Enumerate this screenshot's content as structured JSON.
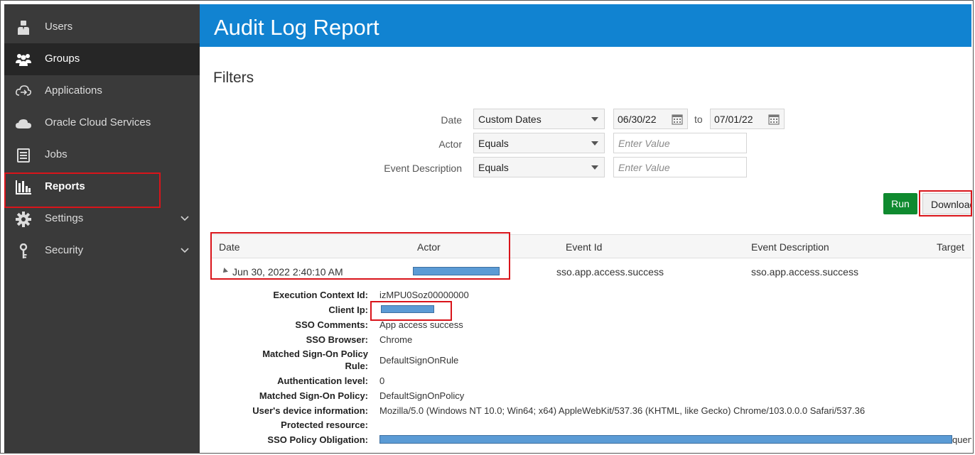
{
  "sidebar": {
    "items": [
      {
        "label": "Users",
        "icon": "user-icon"
      },
      {
        "label": "Groups",
        "icon": "group-icon",
        "active": true
      },
      {
        "label": "Applications",
        "icon": "applications-icon"
      },
      {
        "label": "Oracle Cloud Services",
        "icon": "cloud-icon"
      },
      {
        "label": "Jobs",
        "icon": "jobs-icon"
      },
      {
        "label": "Reports",
        "icon": "reports-icon",
        "highlighted": true
      },
      {
        "label": "Settings",
        "icon": "gear-icon",
        "expandable": true
      },
      {
        "label": "Security",
        "icon": "key-icon",
        "expandable": true
      }
    ]
  },
  "header": {
    "title": "Audit Log Report"
  },
  "filters": {
    "title": "Filters",
    "date_label": "Date",
    "date_mode": "Custom Dates",
    "date_from": "06/30/22",
    "to_label": "to",
    "date_to": "07/01/22",
    "actor_label": "Actor",
    "actor_op": "Equals",
    "actor_placeholder": "Enter Value",
    "event_label": "Event Description",
    "event_op": "Equals",
    "event_placeholder": "Enter Value"
  },
  "buttons": {
    "run": "Run",
    "download": "Download"
  },
  "table": {
    "columns": [
      "Date",
      "Actor",
      "Event Id",
      "Event Description",
      "Target"
    ],
    "row": {
      "date": "Jun 30, 2022 2:40:10 AM",
      "event_id": "sso.app.access.success",
      "event_description": "sso.app.access.success"
    }
  },
  "details": {
    "execution_context_label": "Execution Context Id:",
    "execution_context_value": "izMPU0Soz00000000",
    "client_ip_label": "Client Ip:",
    "sso_comments_label": "SSO Comments:",
    "sso_comments_value": "App access success",
    "sso_browser_label": "SSO Browser:",
    "sso_browser_value": "Chrome",
    "matched_policy_rule_label_1": "Matched Sign-On Policy",
    "matched_policy_rule_label_2": "Rule:",
    "matched_policy_rule_value": "DefaultSignOnRule",
    "auth_level_label": "Authentication level:",
    "auth_level_value": "0",
    "matched_policy_label": "Matched Sign-On Policy:",
    "matched_policy_value": "DefaultSignOnPolicy",
    "device_info_label": "User's device information:",
    "device_info_value": "Mozilla/5.0 (Windows NT 10.0; Win64; x64) AppleWebKit/537.36 (KHTML, like Gecko) Chrome/103.0.0.0 Safari/537.36",
    "protected_resource_label": "Protected resource:",
    "sso_obligation_label": "SSO Policy Obligation:",
    "sso_obligation_tail": "quen"
  },
  "colors": {
    "sidebar_bg": "#3a3a3a",
    "sidebar_active": "#262626",
    "header_bg": "#1183d1",
    "run_button": "#0f8a2f",
    "highlight_red": "#d9141a",
    "redaction_blue": "#5b9bd5"
  }
}
